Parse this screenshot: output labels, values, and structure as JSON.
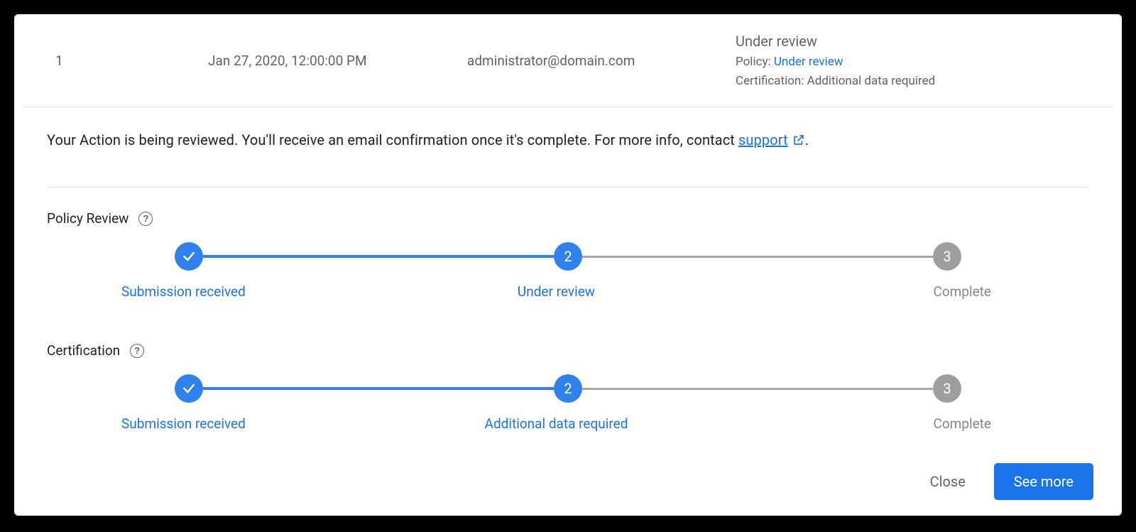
{
  "row": {
    "number": "1",
    "date": "Jan 27, 2020, 12:00:00 PM",
    "email": "administrator@domain.com",
    "status_title": "Under review",
    "policy_label": "Policy: ",
    "policy_value": "Under review",
    "cert_label": "Certification: ",
    "cert_value": "Additional data required"
  },
  "message": {
    "text_before": "Your Action is being reviewed. You'll receive an email confirmation once it's complete. For more info, contact ",
    "link": "support",
    "text_after": "."
  },
  "sections": {
    "policy": {
      "title": "Policy Review",
      "steps": [
        "Submission received",
        "Under review",
        "Complete"
      ],
      "states": [
        "done",
        "active",
        "pending"
      ]
    },
    "cert": {
      "title": "Certification",
      "steps": [
        "Submission received",
        "Additional data required",
        "Complete"
      ],
      "states": [
        "done",
        "active",
        "pending"
      ]
    }
  },
  "buttons": {
    "close": "Close",
    "see_more": "See more"
  },
  "glyphs": {
    "q": "?",
    "two": "2",
    "three": "3"
  }
}
